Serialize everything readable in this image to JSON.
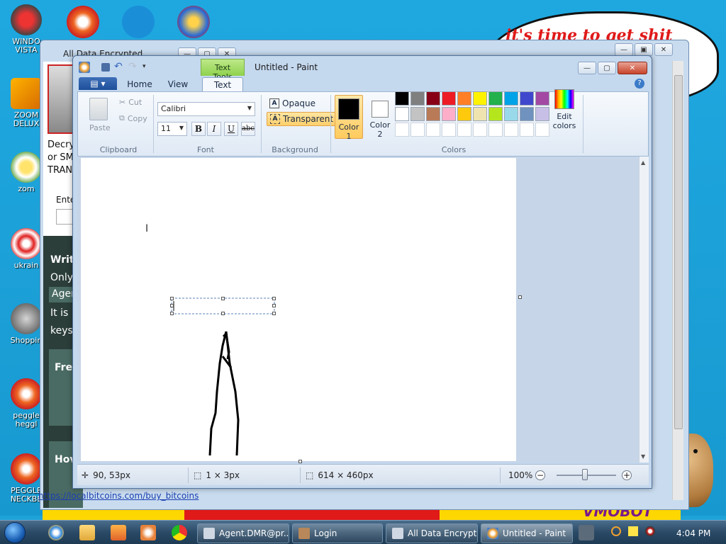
{
  "desktop": {
    "icons": [
      {
        "label": "WINDO\nVISTA"
      },
      {
        "label": "ZOOM\nDELUX"
      },
      {
        "label": "zom"
      },
      {
        "label": "ukrain"
      },
      {
        "label": "Shoppin"
      },
      {
        "label": "peggle\nheggl"
      },
      {
        "label": "PEGGLE\nNECKBE"
      }
    ],
    "cloud_text": "it's time to get shit",
    "vmobot_text": "VMOBOT"
  },
  "back_window": {
    "title": "All Data Encrypted",
    "content_lines": [
      "Decry",
      "or SM",
      "TRAN"
    ],
    "enter_label": "Ente",
    "dark_heading": "Writ",
    "only_text": "Only",
    "agent_chip": "Agen",
    "it_is_text": "It is i",
    "keys_text": "keys",
    "fre_heading": "Fre",
    "how_heading": "Hov",
    "link_text": "https://localbitcoins.com/buy_bitcoins"
  },
  "paint": {
    "title": "Untitled - Paint",
    "contextual_tab": "Text Tools",
    "tabs": {
      "home": "Home",
      "view": "View",
      "text": "Text"
    },
    "clipboard": {
      "paste": "Paste",
      "cut": "Cut",
      "copy": "Copy",
      "label": "Clipboard"
    },
    "font": {
      "family": "Calibri",
      "size": "11",
      "bold": "B",
      "italic": "I",
      "underline": "U",
      "strike": "abc",
      "label": "Font"
    },
    "background": {
      "opaque": "Opaque",
      "transparent": "Transparent",
      "label": "Background"
    },
    "colors": {
      "color1_label": "Color\n1",
      "color2_label": "Color\n2",
      "color1": "#000000",
      "color2": "#ffffff",
      "edit_colors": "Edit\ncolors",
      "label": "Colors",
      "palette": [
        "#000000",
        "#7f7f7f",
        "#880015",
        "#ed1c24",
        "#ff7f27",
        "#fff200",
        "#22b14c",
        "#00a2e8",
        "#3f48cc",
        "#a349a4",
        "#ffffff",
        "#c3c3c3",
        "#b97a57",
        "#ffaec9",
        "#ffc90e",
        "#efe4b0",
        "#b5e61d",
        "#99d9ea",
        "#7092be",
        "#c8bfe7",
        "#ffffff",
        "#ffffff",
        "#ffffff",
        "#ffffff",
        "#ffffff",
        "#ffffff",
        "#ffffff",
        "#ffffff",
        "#ffffff",
        "#ffffff"
      ]
    },
    "status": {
      "cursor_pos": "90, 53px",
      "selection_size": "1 × 3px",
      "canvas_size": "614 × 460px",
      "zoom": "100%"
    }
  },
  "taskbar": {
    "buttons": [
      {
        "label": "Agent.DMR@pr..."
      },
      {
        "label": "Login"
      },
      {
        "label": "All Data Encrypt..."
      },
      {
        "label": "Untitled - Paint"
      }
    ],
    "clock": "4:04 PM"
  }
}
